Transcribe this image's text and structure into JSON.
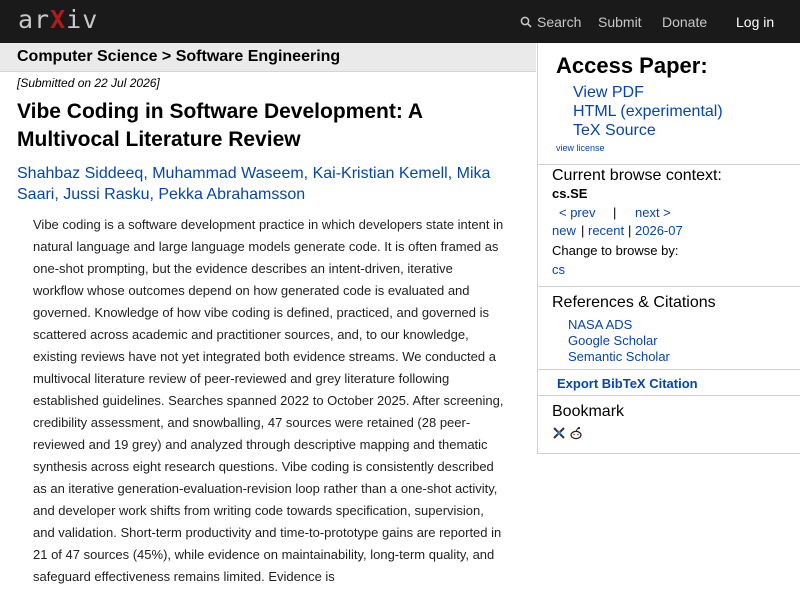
{
  "header": {
    "logo_prefix": "ar",
    "logo_x": "X",
    "logo_suffix": "iv",
    "nav": {
      "search": "Search",
      "submit": "Submit",
      "donate": "Donate",
      "login": "Log in"
    }
  },
  "breadcrumb": "Computer Science > Software Engineering",
  "paper": {
    "submitted": "[Submitted on 22 Jul 2026]",
    "title": "Vibe Coding in Software Development: A Multivocal Literature Review",
    "authors": "Shahbaz Siddeeq, Muhammad Waseem, Kai-Kristian Kemell, Mika Saari, Jussi Rasku, Pekka Abrahamsson",
    "abstract": "Vibe coding is a software development practice in which developers state intent in natural language and large language models generate code. It is often framed as one-shot prompting, but the evidence describes an intent-driven, iterative workflow whose outcomes depend on how generated code is evaluated and governed. Knowledge of how vibe coding is defined, practiced, and governed is scattered across academic and practitioner sources, and, to our knowledge, existing reviews have not yet integrated both evidence streams. We conducted a multivocal literature review of peer-reviewed and grey literature following established guidelines. Searches spanned 2022 to October 2025. After screening, credibility assessment, and snowballing, 47 sources were retained (28 peer-reviewed and 19 grey) and analyzed through descriptive mapping and thematic synthesis across eight research questions. Vibe coding is consistently described as an iterative generation-evaluation-revision loop rather than a one-shot activity, and developer work shifts from writing code towards specification, supervision, and validation. Short-term productivity and time-to-prototype gains are reported in 21 of 47 sources (45%), while evidence on maintainability, long-term quality, and safeguard effectiveness remains limited. Evidence is"
  },
  "sidebar": {
    "access_title": "Access Paper:",
    "access_links": [
      "View PDF",
      "HTML (experimental)",
      "TeX Source"
    ],
    "view_license": "view license",
    "context_title": "Current browse context:",
    "context_id": "cs.SE",
    "prev": "< prev",
    "sep_bar": "|",
    "next": "next >",
    "new": "new",
    "recent": "recent",
    "month": "2026-07",
    "change_browse": "Change to browse by:",
    "browse_cs": "cs",
    "refs_title": "References & Citations",
    "refs": [
      "NASA ADS",
      "Google Scholar",
      "Semantic Scholar"
    ],
    "export": "Export BibTeX Citation",
    "bookmark_title": "Bookmark",
    "bookmark_icons": [
      "bibsonomy-icon",
      "reddit-icon"
    ]
  },
  "colors": {
    "topbar": "#1a1a1a",
    "brand_red": "#b31b1b",
    "link": "#0645ad"
  }
}
